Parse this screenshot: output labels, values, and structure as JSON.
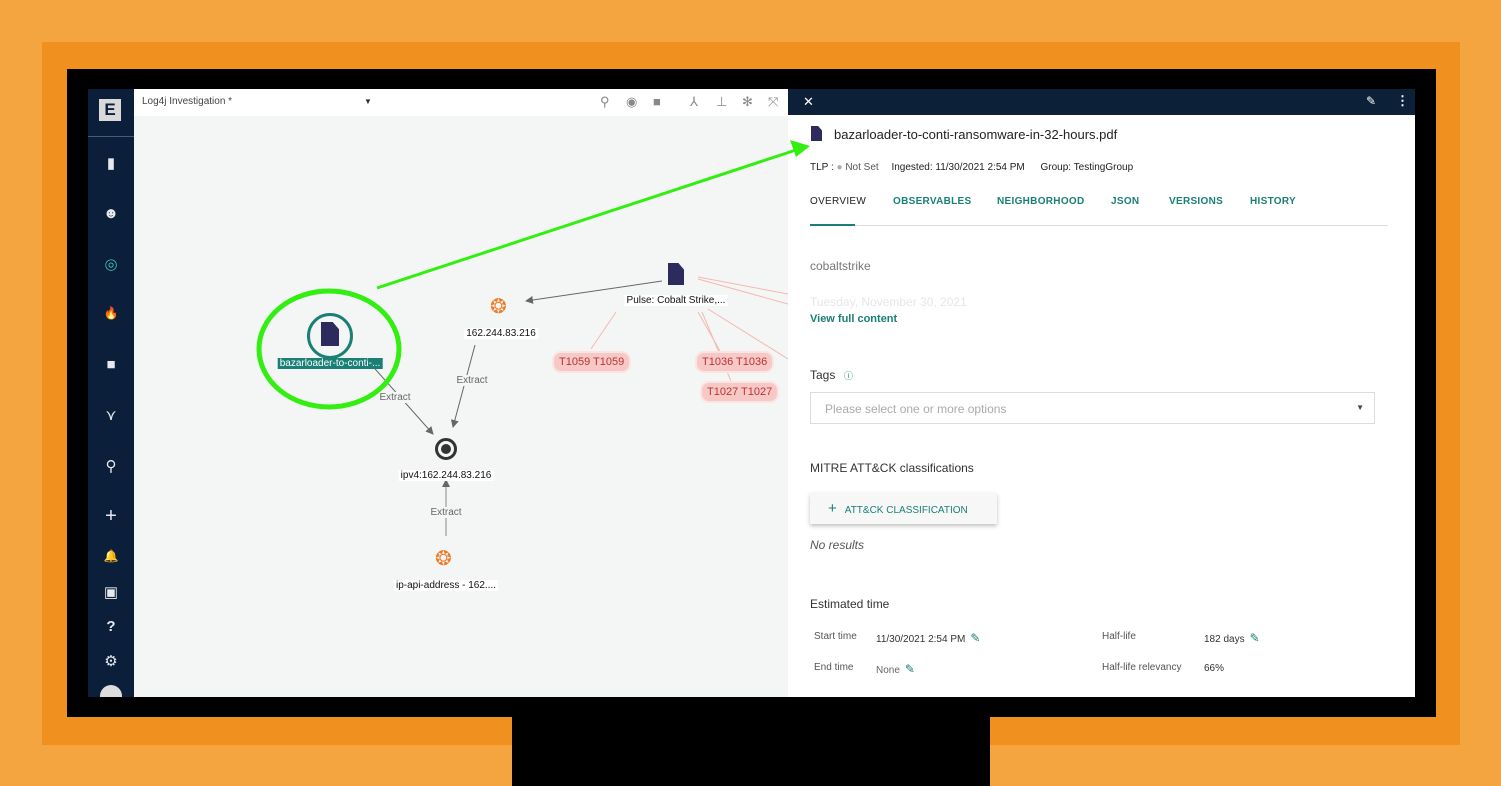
{
  "app": {
    "logo": "E",
    "investigation_title": "Log4j Investigation *"
  },
  "sidebar": {
    "items": [
      {
        "icon": "chart-icon",
        "glyph": "▮"
      },
      {
        "icon": "robot-icon",
        "glyph": "☻"
      },
      {
        "icon": "target-icon",
        "glyph": "◎"
      },
      {
        "icon": "fire-icon",
        "glyph": "🔥"
      },
      {
        "icon": "briefcase-icon",
        "glyph": "■"
      },
      {
        "icon": "graph-icon",
        "glyph": "⋎"
      },
      {
        "icon": "search-icon",
        "glyph": "⚲"
      },
      {
        "icon": "plus-icon",
        "glyph": "+"
      },
      {
        "icon": "bell-icon",
        "glyph": "🔔"
      },
      {
        "icon": "calendar-icon",
        "glyph": "▣"
      },
      {
        "icon": "help-icon",
        "glyph": "?"
      },
      {
        "icon": "settings-icon",
        "glyph": "⚙"
      }
    ]
  },
  "graph": {
    "nodes": {
      "selected": "bazarloader-to-conti-...",
      "fingerprint1": "162.244.83.216",
      "pulse": "Pulse: Cobalt Strike,...",
      "ipv4": "ipv4:162.244.83.216",
      "ipapi": "ip-api-address - 162...."
    },
    "edge_labels": [
      "Extract",
      "Extract",
      "Extract"
    ],
    "techniques": [
      "T1059 T1059",
      "T1036 T1036",
      "T1027 T1027"
    ]
  },
  "panel": {
    "title": "bazarloader-to-conti-ransomware-in-32-hours.pdf",
    "tlp_label": "TLP :",
    "tlp_value": "Not Set",
    "ingested": "Ingested: 11/30/2021 2:54 PM",
    "group": "Group: TestingGroup",
    "tabs": [
      "OVERVIEW",
      "OBSERVABLES",
      "NEIGHBORHOOD",
      "JSON",
      "VERSIONS",
      "HISTORY"
    ],
    "active_tab": "OVERVIEW",
    "content_line1": "cobaltstrike",
    "content_line2": "Tuesday, November 30, 2021",
    "view_full": "View full content",
    "tags_label": "Tags",
    "tags_placeholder": "Please select one or more options",
    "mitre_label": "MITRE ATT&CK classifications",
    "attck_button": "ATT&CK CLASSIFICATION",
    "no_results": "No results",
    "estimated_label": "Estimated time",
    "start_label": "Start time",
    "start_value": "11/30/2021 2:54 PM",
    "end_label": "End time",
    "end_value": "None",
    "halflife_label": "Half-life",
    "halflife_value": "182 days",
    "relevancy_label": "Half-life relevancy",
    "relevancy_value": "66%"
  },
  "colors": {
    "accent": "#1a7f74",
    "sidebar": "#0b1f3a",
    "annotation": "#33ee11"
  }
}
